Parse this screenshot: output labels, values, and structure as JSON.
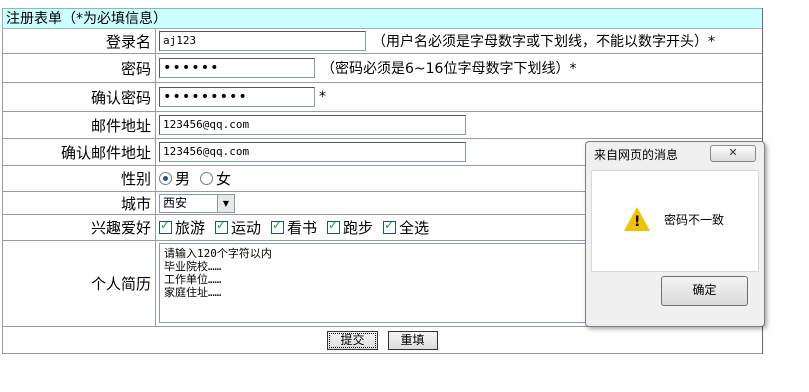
{
  "form": {
    "title": "注册表单（*为必填信息）",
    "fields": {
      "login_label": "登录名",
      "login_value": "aj123",
      "login_hint": "（用户名必须是字母数字或下划线，不能以数字开头）*",
      "password_label": "密码",
      "password_value": "••••••",
      "password_hint": "（密码必须是6~16位字母数字下划线）*",
      "confirm_password_label": "确认密码",
      "confirm_password_value": "•••••••••",
      "confirm_password_star": "*",
      "email_label": "邮件地址",
      "email_value": "123456@qq.com",
      "confirm_email_label": "确认邮件地址",
      "confirm_email_value": "123456@qq.com",
      "gender_label": "性别",
      "gender_male": "男",
      "gender_female": "女",
      "city_label": "城市",
      "city_value": "西安",
      "hobby_label": "兴趣爱好",
      "hobbies": [
        "旅游",
        "运动",
        "看书",
        "跑步",
        "全选"
      ],
      "resume_label": "个人简历",
      "resume_text": "请输入120个字符以内\n毕业院校……\n工作单位……\n家庭住址……"
    },
    "submit_label": "提交",
    "reset_label": "重填"
  },
  "dialog": {
    "title": "来自网页的消息",
    "close_glyph": "✕",
    "message": "密码不一致",
    "ok_label": "确定",
    "icon": "warning-icon"
  }
}
